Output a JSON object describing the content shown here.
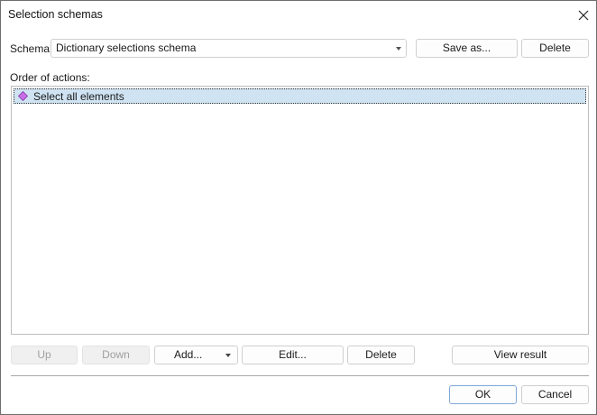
{
  "window": {
    "title": "Selection schemas"
  },
  "schema": {
    "label": "Schema:",
    "value": "Dictionary selections schema",
    "save_as": "Save as...",
    "delete": "Delete"
  },
  "actions": {
    "label": "Order of actions:",
    "items": [
      {
        "label": "Select all elements",
        "icon": "purple-diamond-icon",
        "selected": true
      }
    ]
  },
  "toolbar": {
    "up": "Up",
    "down": "Down",
    "add": "Add...",
    "edit": "Edit...",
    "delete": "Delete",
    "view_result": "View result"
  },
  "footer": {
    "ok": "OK",
    "cancel": "Cancel"
  },
  "colors": {
    "selection": "#cfe3f2",
    "diamond": "#c86fe8",
    "diamond_border": "#7a2aa0"
  }
}
